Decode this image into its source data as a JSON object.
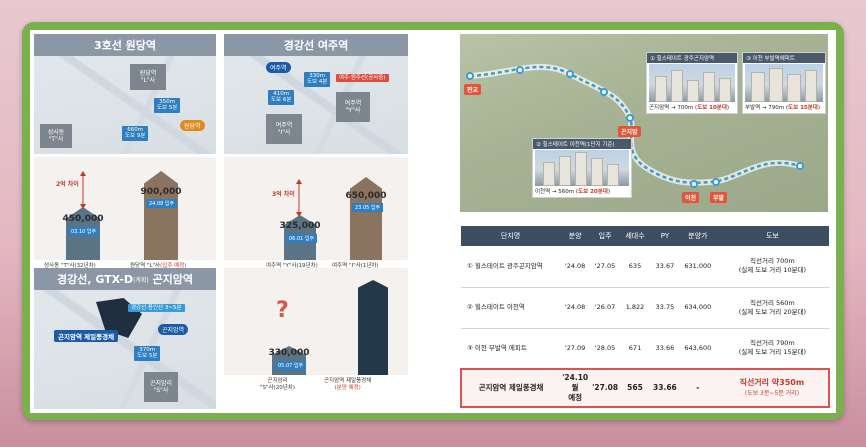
{
  "panels": {
    "wondang": {
      "title": "3호선 원당역",
      "map": {
        "block_a": "원당역\n\"L\"사",
        "block_b": "성사동\n\"T\"사",
        "dist_a": "350m\n도보 5분",
        "dist_b": "660m\n도보 9분",
        "station": "원당역"
      },
      "chart": {
        "gap": "2억 차이",
        "left_price": "450,000",
        "left_tag": "03.10 입주",
        "left_caption": "성사동 \"T\"사(32년차)",
        "right_price": "900,000",
        "right_tag": "24.08 입주",
        "right_caption_a": "원당역 \"L\"사",
        "right_caption_b": "(입주 예정)"
      }
    },
    "yeoju": {
      "title": "경강선 여주역",
      "map": {
        "station": "여주역",
        "dist_a": "330m\n도보 4분",
        "dist_b": "410m\n도보 6분",
        "label_c": "여주·원주선(공사중)",
        "block_a": "여주역\n\"I\"사",
        "block_b": "여주역\n\"Y\"사"
      },
      "chart": {
        "gap": "3억 차이",
        "left_price": "325,000",
        "left_tag": "06.01 입주",
        "left_caption": "여주역 \"Y\"사(19년차)",
        "right_price": "650,000",
        "right_tag": "23.05 입주",
        "right_caption": "여주역 \"I\"사(1년차)"
      }
    },
    "gonjiam": {
      "title_a": "경강선, GTX-D",
      "title_small": "(계획)",
      "title_b": "곤지암역",
      "map": {
        "label_small": "경강선·용인선 3~5분",
        "site": "곤지암역 제일풍경채",
        "station": "곤지암역",
        "dist": "370m\n도보 5분",
        "block": "곤지암리\n\"S\"사"
      },
      "chart": {
        "question": "?",
        "left_price": "330,000",
        "left_tag": "05.07 입주",
        "left_caption_a": "곤지암리",
        "left_caption_b": "\"S\"사(20년차)",
        "right_caption_a": "곤지암역 제일풍경채",
        "right_caption_b": "(분양 예정)"
      }
    }
  },
  "route_map": {
    "stations": [
      "판교",
      "곤지암",
      "이천",
      "부발"
    ],
    "card1": {
      "header": "① 힐스테이트 광주곤지암역",
      "footer_a": "곤지암역 → 700m (",
      "footer_b": "도보 10분대",
      "footer_c": ")"
    },
    "card2": {
      "header": "③ 이천 부발역에피트",
      "footer_a": "부발역 → 790m (",
      "footer_b": "도보 15분대",
      "footer_c": ")"
    },
    "card3": {
      "header": "② 힐스테이트 이천역(1단지 기준)",
      "footer_a": "이천역 → 560m (",
      "footer_b": "도보 20분대",
      "footer_c": ")"
    }
  },
  "table": {
    "headers": [
      "단지명",
      "분양",
      "입주",
      "세대수",
      "PY",
      "분양가",
      "도보"
    ],
    "rows": [
      {
        "name": "① 힐스테이트 광주곤지암역",
        "sale": "'24.08",
        "move": "'27.05",
        "units": "635",
        "py": "33.67",
        "price": "631,000",
        "walk_a": "직선거리 700m",
        "walk_b": "(실제 도보 거리 10분대)"
      },
      {
        "name": "② 힐스테이트 이천역",
        "sale": "'24.08",
        "move": "'26.07",
        "units": "1,822",
        "py": "33.75",
        "price": "634,000",
        "walk_a": "직선거리 560m",
        "walk_b": "(실제 도보 거리 20분대)"
      },
      {
        "name": "③ 이천 부발역 에피트",
        "sale": "'27.09",
        "move": "'28.05",
        "units": "671",
        "py": "33.66",
        "price": "643,600",
        "walk_a": "직선거리 790m",
        "walk_b": "(실제 도보 거리 15분대)"
      }
    ],
    "highlight": {
      "name": "곤지암역 제일풍경채",
      "sale_a": "'24.10월",
      "sale_b": "예정",
      "move": "'27.08",
      "units": "565",
      "py": "33.66",
      "price": "-",
      "walk_a": "직선거리 약350m",
      "walk_b": "(도보 3분~5분 거리)"
    }
  },
  "colors": {
    "frame": "#7bb04e",
    "panel_header": "#8b97a4",
    "table_header": "#3d4e60",
    "accent_red": "#c0392b",
    "accent_blue": "#2f7ec0",
    "accent_orange": "#e08a1e"
  }
}
